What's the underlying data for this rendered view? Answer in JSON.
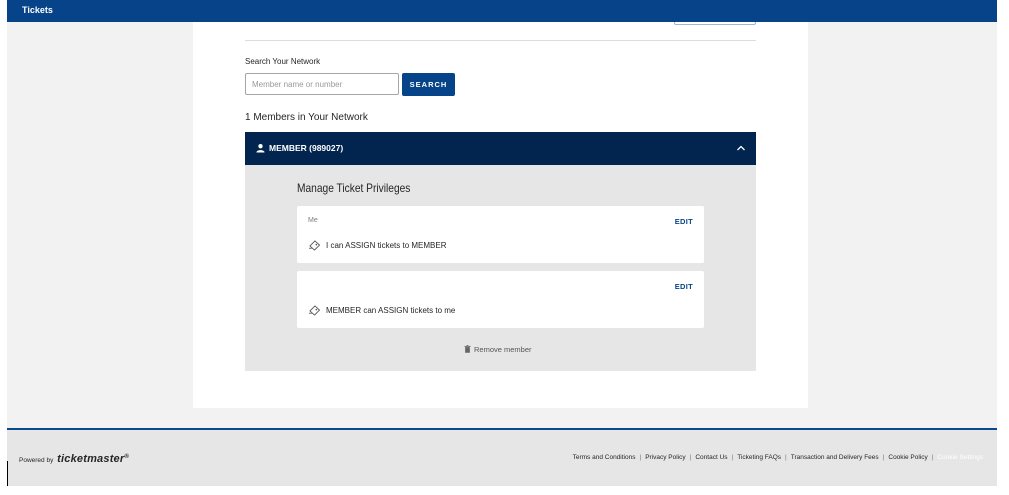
{
  "header": {
    "title": "Tickets"
  },
  "search": {
    "label": "Search Your Network",
    "placeholder": "Member name or number",
    "value": "",
    "button_label": "SEARCH"
  },
  "network": {
    "count_text": "1 Members in Your Network"
  },
  "member": {
    "name": "MEMBER (989027)",
    "panel_title": "Manage Ticket Privileges",
    "privileges": [
      {
        "owner_label": "Me",
        "edit_label": "EDIT",
        "text": "I can ASSIGN tickets to MEMBER",
        "icon": "ticket-icon"
      },
      {
        "owner_label": "",
        "edit_label": "EDIT",
        "text": "MEMBER can ASSIGN tickets to me",
        "icon": "ticket-icon"
      }
    ],
    "remove_label": "Remove member"
  },
  "footer": {
    "powered_by": "Powered by",
    "brand": "ticketmaster",
    "brand_mark": "®",
    "links": [
      "Terms and Conditions",
      "Privacy Policy",
      "Contact Us",
      "Ticketing FAQs",
      "Transaction and Delivery Fees",
      "Cookie Policy",
      "Cookie Settings"
    ]
  },
  "colors": {
    "header_blue": "#074388",
    "member_bar": "#02254f",
    "panel_gray": "#e6e6e6",
    "page_gray": "#f2f2f2"
  }
}
